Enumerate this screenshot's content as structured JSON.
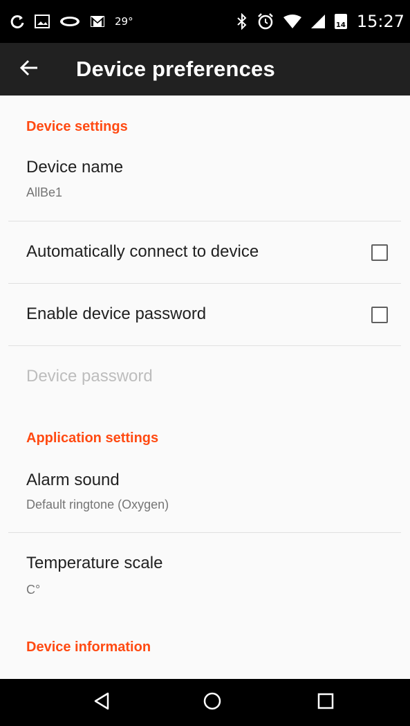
{
  "status_bar": {
    "temperature": "29°",
    "date_badge": "14",
    "time": "15:27",
    "left_icons": [
      "sync-icon",
      "image-icon",
      "app-logo-icon",
      "gmail-icon"
    ],
    "right_icons": [
      "bluetooth-icon",
      "alarm-icon",
      "wifi-icon",
      "signal-icon",
      "calendar-icon"
    ]
  },
  "toolbar": {
    "title": "Device preferences",
    "back_icon": "arrow-left-icon"
  },
  "sections": {
    "device_settings": "Device settings",
    "application_settings": "Application settings",
    "device_information": "Device information"
  },
  "prefs": {
    "device_name": {
      "title": "Device name",
      "summary": "AllBe1"
    },
    "auto_connect": {
      "title": "Automatically connect to device",
      "checked": false
    },
    "enable_password": {
      "title": "Enable device password",
      "checked": false
    },
    "device_password": {
      "title": "Device password",
      "enabled": false
    },
    "alarm_sound": {
      "title": "Alarm sound",
      "summary": "Default ringtone (Oxygen)"
    },
    "temperature_scale": {
      "title": "Temperature scale",
      "summary": "C°"
    }
  },
  "colors": {
    "accent": "#ff4a12",
    "toolbar": "#212121",
    "background": "#fafafa"
  }
}
